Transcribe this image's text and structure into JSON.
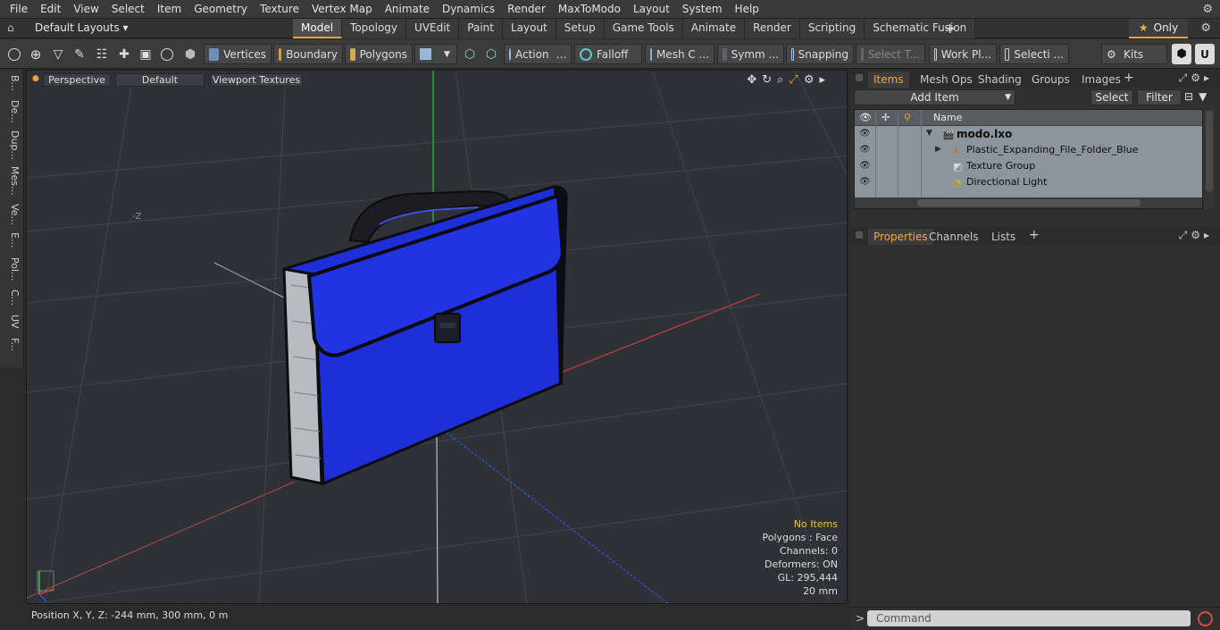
{
  "menu": [
    "File",
    "Edit",
    "View",
    "Select",
    "Item",
    "Geometry",
    "Texture",
    "Vertex Map",
    "Animate",
    "Dynamics",
    "Render",
    "MaxToModo",
    "Layout",
    "System",
    "Help"
  ],
  "layoutbar": {
    "default_layouts": "Default Layouts ▾",
    "tabs": [
      "Model",
      "Topology",
      "UVEdit",
      "Paint",
      "Layout",
      "Setup",
      "Game Tools",
      "Animate",
      "Render",
      "Scripting",
      "Schematic Fusion"
    ],
    "active_tab": "Model",
    "only_label": "Only"
  },
  "toolbar": {
    "vertices": "Vertices",
    "boundary": "Boundary",
    "polygons": "Polygons",
    "action": "Action",
    "falloff": "Falloff",
    "mesh": "Mesh C ...",
    "symm": "Symm ...",
    "snapping": "Snapping",
    "select_t": "Select T...",
    "work_pl": "Work Pl...",
    "selecti": "Selecti ...",
    "kits": "Kits"
  },
  "lefttabs": [
    "B...",
    "De...",
    "Dup...",
    "Mes...",
    "Ve...",
    "E...",
    "Pol...",
    "C...",
    "UV",
    "F..."
  ],
  "viewport": {
    "perspective": "Perspective",
    "default": "Default",
    "textures": "Viewport Textures",
    "axis_label": "-Z",
    "stats": {
      "no_items": "No Items",
      "polygons": "Polygons : Face",
      "channels": "Channels: 0",
      "deformers": "Deformers: ON",
      "gl": "GL: 295,444",
      "scale": "20 mm"
    }
  },
  "status": {
    "position": "Position X, Y, Z:   -244 mm, 300 mm, 0 m"
  },
  "items_panel": {
    "tabs": [
      "Items",
      "Mesh Ops",
      "Shading",
      "Groups",
      "Images"
    ],
    "active": "Items",
    "add_item": "Add Item",
    "select": "Select",
    "filter": "Filter",
    "col_name": "Name",
    "rows": [
      {
        "name": "modo.lxo"
      },
      {
        "name": "Plastic_Expanding_File_Folder_Blue"
      },
      {
        "name": "Texture Group"
      },
      {
        "name": "Directional Light"
      }
    ]
  },
  "props_panel": {
    "tabs": [
      "Properties",
      "Channels",
      "Lists"
    ],
    "active": "Properties"
  },
  "command": {
    "placeholder": "Command"
  },
  "colors": {
    "accent": "#e6a13a",
    "folder_blue": "#1f2fd8",
    "viewport_bg": "#2e3236"
  }
}
